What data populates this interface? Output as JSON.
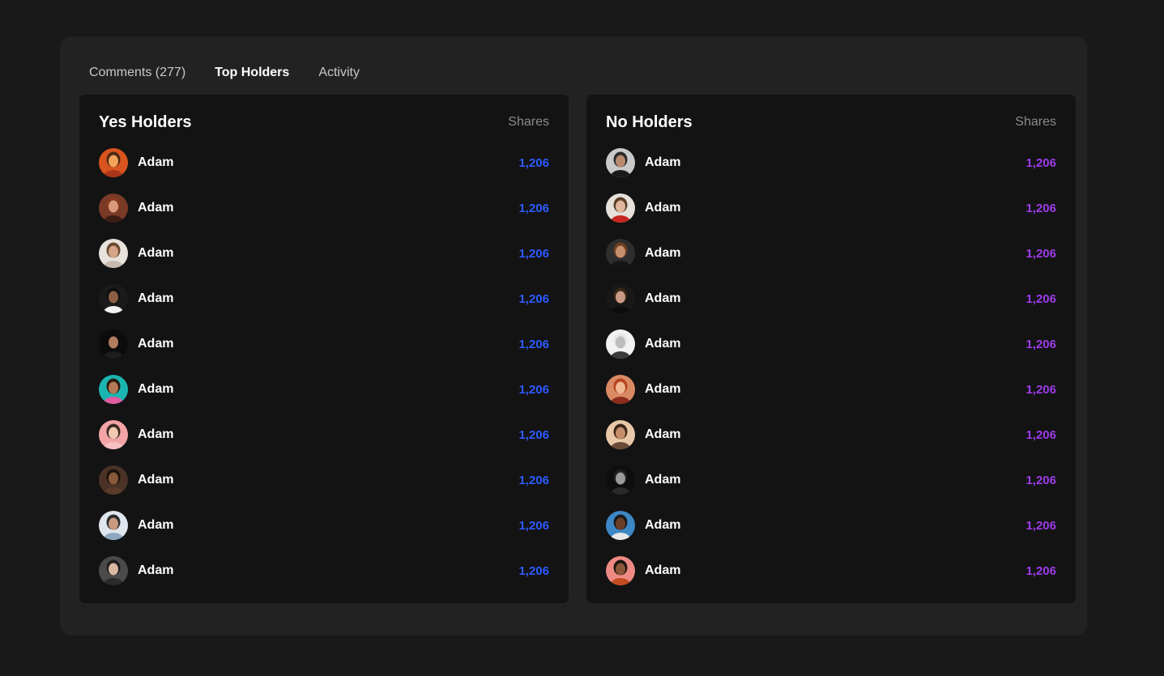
{
  "tabs": [
    {
      "label": "Comments (277)",
      "active": false
    },
    {
      "label": "Top Holders",
      "active": true
    },
    {
      "label": "Activity",
      "active": false
    }
  ],
  "accent": {
    "yes": "#2d5bff",
    "no": "#9d3ce8"
  },
  "yes_holders": {
    "title": "Yes Holders",
    "shares_label": "Shares",
    "rows": [
      {
        "name": "Adam",
        "shares": "1,206",
        "avatar": {
          "bg": "#d9541e",
          "skin": "#f2a25a",
          "hair": "#4a2a14",
          "shirt": "#a8361a"
        }
      },
      {
        "name": "Adam",
        "shares": "1,206",
        "avatar": {
          "bg": "#7a3a28",
          "skin": "#d99a7e",
          "hair": "#8a3b1f",
          "shirt": "#3d1c14"
        }
      },
      {
        "name": "Adam",
        "shares": "1,206",
        "avatar": {
          "bg": "#e8e2dc",
          "skin": "#d6a587",
          "hair": "#6b4a30",
          "shirt": "#c7b9ad"
        }
      },
      {
        "name": "Adam",
        "shares": "1,206",
        "avatar": {
          "bg": "#1a1a1a",
          "skin": "#8c5f45",
          "hair": "#0f0f0f",
          "shirt": "#f2f2f2"
        }
      },
      {
        "name": "Adam",
        "shares": "1,206",
        "avatar": {
          "bg": "#0c0c0c",
          "skin": "#b07c5e",
          "hair": "#0a0a0a",
          "shirt": "#1e1e1e"
        }
      },
      {
        "name": "Adam",
        "shares": "1,206",
        "avatar": {
          "bg": "#1ab5b0",
          "skin": "#b57a55",
          "hair": "#2b1a10",
          "shirt": "#e35aa0"
        }
      },
      {
        "name": "Adam",
        "shares": "1,206",
        "avatar": {
          "bg": "#f3a4a6",
          "skin": "#f0c9b0",
          "hair": "#3a2a20",
          "shirt": "#f7c0c3"
        }
      },
      {
        "name": "Adam",
        "shares": "1,206",
        "avatar": {
          "bg": "#4a3226",
          "skin": "#8a5a3c",
          "hair": "#1c120c",
          "shirt": "#5b3c2a"
        }
      },
      {
        "name": "Adam",
        "shares": "1,206",
        "avatar": {
          "bg": "#dfe6ee",
          "skin": "#c99a7e",
          "hair": "#2c2c2c",
          "shirt": "#8fa8c2"
        }
      },
      {
        "name": "Adam",
        "shares": "1,206",
        "avatar": {
          "bg": "#4a4a4a",
          "skin": "#d9b8a2",
          "hair": "#1f1f1f",
          "shirt": "#2a2a2a"
        }
      }
    ]
  },
  "no_holders": {
    "title": "No Holders",
    "shares_label": "Shares",
    "rows": [
      {
        "name": "Adam",
        "shares": "1,206",
        "avatar": {
          "bg": "#c9c9c9",
          "skin": "#b88a70",
          "hair": "#2a2a2a",
          "shirt": "#1a1a1a"
        }
      },
      {
        "name": "Adam",
        "shares": "1,206",
        "avatar": {
          "bg": "#e5e0da",
          "skin": "#e0b79c",
          "hair": "#5a3e2a",
          "shirt": "#c8261f"
        }
      },
      {
        "name": "Adam",
        "shares": "1,206",
        "avatar": {
          "bg": "#2e2e2e",
          "skin": "#c78f6c",
          "hair": "#6e3e22",
          "shirt": "#151515"
        }
      },
      {
        "name": "Adam",
        "shares": "1,206",
        "avatar": {
          "bg": "#181818",
          "skin": "#c99b84",
          "hair": "#3a2618",
          "shirt": "#0d0d0d"
        }
      },
      {
        "name": "Adam",
        "shares": "1,206",
        "avatar": {
          "bg": "#f2f2f2",
          "skin": "#bdbdbd",
          "hair": "#e6e6e6",
          "shirt": "#3a3a3a"
        }
      },
      {
        "name": "Adam",
        "shares": "1,206",
        "avatar": {
          "bg": "#d98a64",
          "skin": "#f0b894",
          "hair": "#b8421e",
          "shirt": "#8c2c1c"
        }
      },
      {
        "name": "Adam",
        "shares": "1,206",
        "avatar": {
          "bg": "#e8c8a8",
          "skin": "#c48e6a",
          "hair": "#3b2618",
          "shirt": "#6a4a38"
        }
      },
      {
        "name": "Adam",
        "shares": "1,206",
        "avatar": {
          "bg": "#0e0e0e",
          "skin": "#9a9a9a",
          "hair": "#1e1e1e",
          "shirt": "#2a2a2a"
        }
      },
      {
        "name": "Adam",
        "shares": "1,206",
        "avatar": {
          "bg": "#3d87c4",
          "skin": "#6b3f27",
          "hair": "#1a1a1a",
          "shirt": "#e8e8e8"
        }
      },
      {
        "name": "Adam",
        "shares": "1,206",
        "avatar": {
          "bg": "#ee8a84",
          "skin": "#8a5538",
          "hair": "#1f1410",
          "shirt": "#c24c20"
        }
      }
    ]
  }
}
